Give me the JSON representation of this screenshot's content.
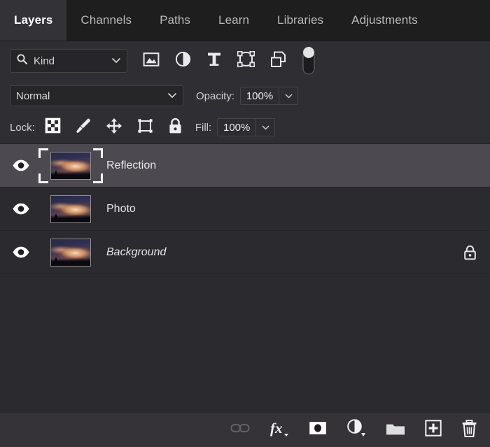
{
  "panel": {
    "title": "Layers",
    "tabs": [
      {
        "label": "Layers",
        "active": true
      },
      {
        "label": "Channels",
        "active": false
      },
      {
        "label": "Paths",
        "active": false
      },
      {
        "label": "Learn",
        "active": false
      },
      {
        "label": "Libraries",
        "active": false
      },
      {
        "label": "Adjustments",
        "active": false
      }
    ]
  },
  "filter": {
    "search_icon": "search-icon",
    "kind_label": "Kind",
    "chevron": "chevron-down-icon",
    "icons": [
      {
        "name": "filter-pixel-layers-icon"
      },
      {
        "name": "filter-adjustment-layers-icon"
      },
      {
        "name": "filter-type-layers-icon"
      },
      {
        "name": "filter-shape-layers-icon"
      },
      {
        "name": "filter-smart-object-layers-icon"
      }
    ],
    "toggle": {
      "name": "filter-enable-toggle",
      "state": "on"
    }
  },
  "blend": {
    "mode": "Normal",
    "opacity_label": "Opacity:",
    "opacity_value": "100%"
  },
  "lock": {
    "label": "Lock:",
    "icons": [
      {
        "name": "lock-transparent-pixels-icon"
      },
      {
        "name": "lock-image-pixels-icon"
      },
      {
        "name": "lock-position-icon"
      },
      {
        "name": "lock-artboard-nesting-icon"
      },
      {
        "name": "lock-all-icon"
      }
    ],
    "fill_label": "Fill:",
    "fill_value": "100%"
  },
  "layers": [
    {
      "name": "Reflection",
      "visible": true,
      "selected": true,
      "italic": false,
      "locked": false
    },
    {
      "name": "Photo",
      "visible": true,
      "selected": false,
      "italic": false,
      "locked": false
    },
    {
      "name": "Background",
      "visible": true,
      "selected": false,
      "italic": true,
      "locked": true
    }
  ],
  "bottom_bar": [
    {
      "name": "link-layers-button",
      "label": "Link layers",
      "disabled": true
    },
    {
      "name": "layer-style-button",
      "label": "fx"
    },
    {
      "name": "add-layer-mask-button",
      "label": "Add layer mask"
    },
    {
      "name": "new-adjustment-layer-button",
      "label": "New fill or adjustment layer"
    },
    {
      "name": "new-group-button",
      "label": "Create a new group"
    },
    {
      "name": "new-layer-button",
      "label": "Create a new layer"
    },
    {
      "name": "delete-layer-button",
      "label": "Delete layer"
    }
  ],
  "colors": {
    "panel_bg": "#2b2a2e",
    "header_bg": "#1e1e1e",
    "row_selected": "#4c4950",
    "toolbar_bg": "#353338",
    "text": "#e6e6e6"
  }
}
